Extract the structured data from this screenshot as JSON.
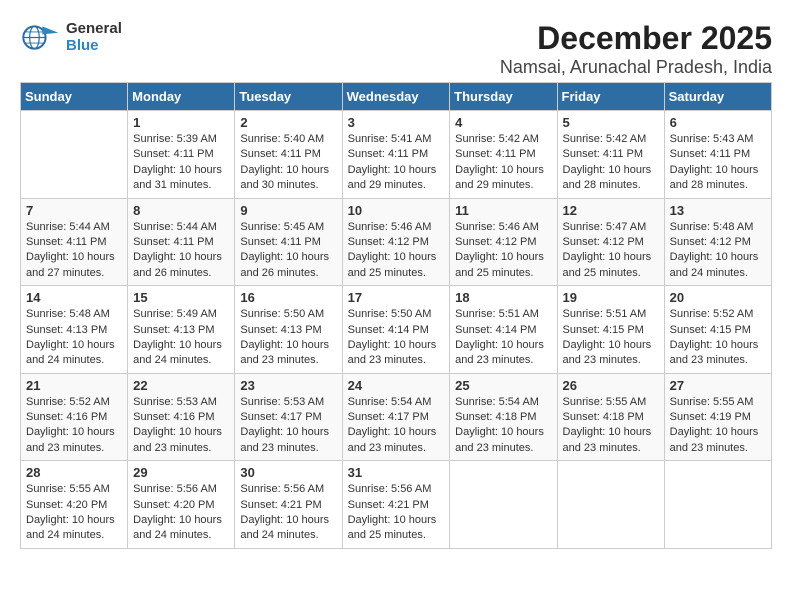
{
  "header": {
    "title": "December 2025",
    "location": "Namsai, Arunachal Pradesh, India",
    "logo_general": "General",
    "logo_blue": "Blue"
  },
  "calendar": {
    "days_of_week": [
      "Sunday",
      "Monday",
      "Tuesday",
      "Wednesday",
      "Thursday",
      "Friday",
      "Saturday"
    ],
    "weeks": [
      [
        {
          "day": "",
          "info": ""
        },
        {
          "day": "1",
          "info": "Sunrise: 5:39 AM\nSunset: 4:11 PM\nDaylight: 10 hours\nand 31 minutes."
        },
        {
          "day": "2",
          "info": "Sunrise: 5:40 AM\nSunset: 4:11 PM\nDaylight: 10 hours\nand 30 minutes."
        },
        {
          "day": "3",
          "info": "Sunrise: 5:41 AM\nSunset: 4:11 PM\nDaylight: 10 hours\nand 29 minutes."
        },
        {
          "day": "4",
          "info": "Sunrise: 5:42 AM\nSunset: 4:11 PM\nDaylight: 10 hours\nand 29 minutes."
        },
        {
          "day": "5",
          "info": "Sunrise: 5:42 AM\nSunset: 4:11 PM\nDaylight: 10 hours\nand 28 minutes."
        },
        {
          "day": "6",
          "info": "Sunrise: 5:43 AM\nSunset: 4:11 PM\nDaylight: 10 hours\nand 28 minutes."
        }
      ],
      [
        {
          "day": "7",
          "info": "Sunrise: 5:44 AM\nSunset: 4:11 PM\nDaylight: 10 hours\nand 27 minutes."
        },
        {
          "day": "8",
          "info": "Sunrise: 5:44 AM\nSunset: 4:11 PM\nDaylight: 10 hours\nand 26 minutes."
        },
        {
          "day": "9",
          "info": "Sunrise: 5:45 AM\nSunset: 4:11 PM\nDaylight: 10 hours\nand 26 minutes."
        },
        {
          "day": "10",
          "info": "Sunrise: 5:46 AM\nSunset: 4:12 PM\nDaylight: 10 hours\nand 25 minutes."
        },
        {
          "day": "11",
          "info": "Sunrise: 5:46 AM\nSunset: 4:12 PM\nDaylight: 10 hours\nand 25 minutes."
        },
        {
          "day": "12",
          "info": "Sunrise: 5:47 AM\nSunset: 4:12 PM\nDaylight: 10 hours\nand 25 minutes."
        },
        {
          "day": "13",
          "info": "Sunrise: 5:48 AM\nSunset: 4:12 PM\nDaylight: 10 hours\nand 24 minutes."
        }
      ],
      [
        {
          "day": "14",
          "info": "Sunrise: 5:48 AM\nSunset: 4:13 PM\nDaylight: 10 hours\nand 24 minutes."
        },
        {
          "day": "15",
          "info": "Sunrise: 5:49 AM\nSunset: 4:13 PM\nDaylight: 10 hours\nand 24 minutes."
        },
        {
          "day": "16",
          "info": "Sunrise: 5:50 AM\nSunset: 4:13 PM\nDaylight: 10 hours\nand 23 minutes."
        },
        {
          "day": "17",
          "info": "Sunrise: 5:50 AM\nSunset: 4:14 PM\nDaylight: 10 hours\nand 23 minutes."
        },
        {
          "day": "18",
          "info": "Sunrise: 5:51 AM\nSunset: 4:14 PM\nDaylight: 10 hours\nand 23 minutes."
        },
        {
          "day": "19",
          "info": "Sunrise: 5:51 AM\nSunset: 4:15 PM\nDaylight: 10 hours\nand 23 minutes."
        },
        {
          "day": "20",
          "info": "Sunrise: 5:52 AM\nSunset: 4:15 PM\nDaylight: 10 hours\nand 23 minutes."
        }
      ],
      [
        {
          "day": "21",
          "info": "Sunrise: 5:52 AM\nSunset: 4:16 PM\nDaylight: 10 hours\nand 23 minutes."
        },
        {
          "day": "22",
          "info": "Sunrise: 5:53 AM\nSunset: 4:16 PM\nDaylight: 10 hours\nand 23 minutes."
        },
        {
          "day": "23",
          "info": "Sunrise: 5:53 AM\nSunset: 4:17 PM\nDaylight: 10 hours\nand 23 minutes."
        },
        {
          "day": "24",
          "info": "Sunrise: 5:54 AM\nSunset: 4:17 PM\nDaylight: 10 hours\nand 23 minutes."
        },
        {
          "day": "25",
          "info": "Sunrise: 5:54 AM\nSunset: 4:18 PM\nDaylight: 10 hours\nand 23 minutes."
        },
        {
          "day": "26",
          "info": "Sunrise: 5:55 AM\nSunset: 4:18 PM\nDaylight: 10 hours\nand 23 minutes."
        },
        {
          "day": "27",
          "info": "Sunrise: 5:55 AM\nSunset: 4:19 PM\nDaylight: 10 hours\nand 23 minutes."
        }
      ],
      [
        {
          "day": "28",
          "info": "Sunrise: 5:55 AM\nSunset: 4:20 PM\nDaylight: 10 hours\nand 24 minutes."
        },
        {
          "day": "29",
          "info": "Sunrise: 5:56 AM\nSunset: 4:20 PM\nDaylight: 10 hours\nand 24 minutes."
        },
        {
          "day": "30",
          "info": "Sunrise: 5:56 AM\nSunset: 4:21 PM\nDaylight: 10 hours\nand 24 minutes."
        },
        {
          "day": "31",
          "info": "Sunrise: 5:56 AM\nSunset: 4:21 PM\nDaylight: 10 hours\nand 25 minutes."
        },
        {
          "day": "",
          "info": ""
        },
        {
          "day": "",
          "info": ""
        },
        {
          "day": "",
          "info": ""
        }
      ]
    ]
  }
}
